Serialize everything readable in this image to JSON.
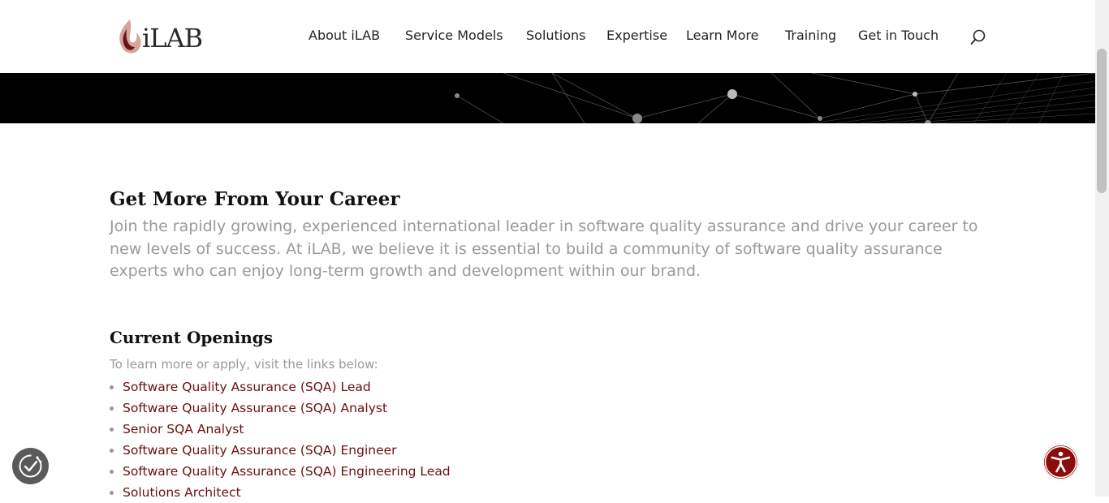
{
  "brand": {
    "logo_text": "iLAB"
  },
  "nav": {
    "items": [
      "About iLAB",
      "Service Models",
      "Solutions",
      "Expertise",
      "Learn More",
      "Training",
      "Get in Touch"
    ]
  },
  "main": {
    "title": "Get More From Your Career",
    "lead": "Join the rapidly growing, experienced international leader in software quality assurance and drive your career to new levels of success.  At iLAB, we believe it is essential to build a community of software quality assurance experts who can enjoy long-term growth and development within our brand.",
    "openings_title": "Current Openings",
    "openings_intro": "To learn more or apply, visit the links below:",
    "openings": [
      "Software Quality Assurance (SQA) Lead",
      "Software Quality Assurance (SQA) Analyst",
      "Senior SQA Analyst",
      "Software Quality Assurance (SQA) Engineer",
      "Software Quality Assurance (SQA) Engineering Lead",
      "Solutions Architect"
    ]
  },
  "icons": {
    "search": "search-icon",
    "cookie": "cookie-consent-icon",
    "accessibility": "accessibility-icon"
  },
  "colors": {
    "link": "#6b1010",
    "accent": "#8b0c0c",
    "muted_text": "#9a9a9a"
  }
}
